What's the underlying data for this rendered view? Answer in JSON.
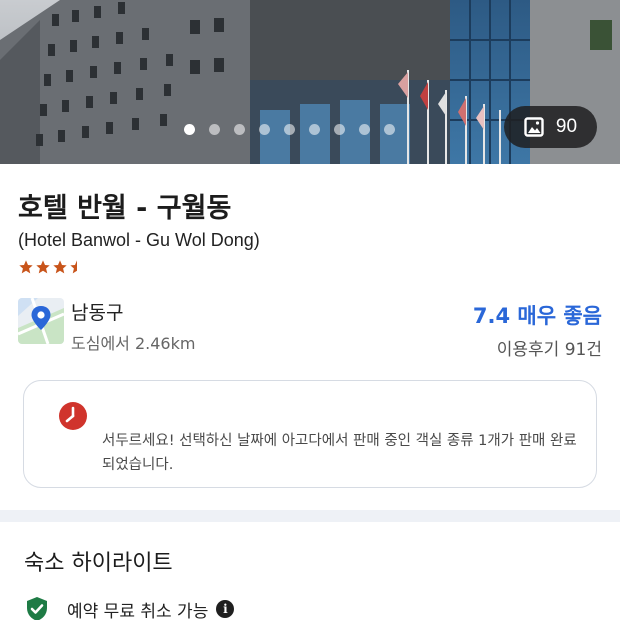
{
  "hero": {
    "photo_count": "90",
    "photo_icon": "image-icon",
    "carousel_dots": 9,
    "active_dot_index": 0
  },
  "hotel": {
    "name": "호텔 반월 - 구월동",
    "name_en": "(Hotel Banwol - Gu Wol Dong)",
    "star_rating": 3.5
  },
  "location": {
    "icon": "map-pin-icon",
    "district": "남동구",
    "distance": "도심에서 2.46km"
  },
  "review": {
    "score": "7.4 매우 좋음",
    "count": "이용후기 91건"
  },
  "alert": {
    "icon": "clock-icon",
    "message": "서두르세요! 선택하신 날짜에 아고다에서 판매 중인 객실 종류 1개가 판매 완료되었습니다."
  },
  "highlights": {
    "title": "숙소 하이라이트",
    "items": [
      {
        "icon": "shield-check-icon",
        "label": "예약 무료 취소 가능",
        "info_icon": "info-icon"
      }
    ]
  },
  "colors": {
    "accent_blue": "#2a67d8",
    "star": "#c8541a",
    "alert_red": "#d0342c",
    "shield_green": "#1e7b45"
  }
}
